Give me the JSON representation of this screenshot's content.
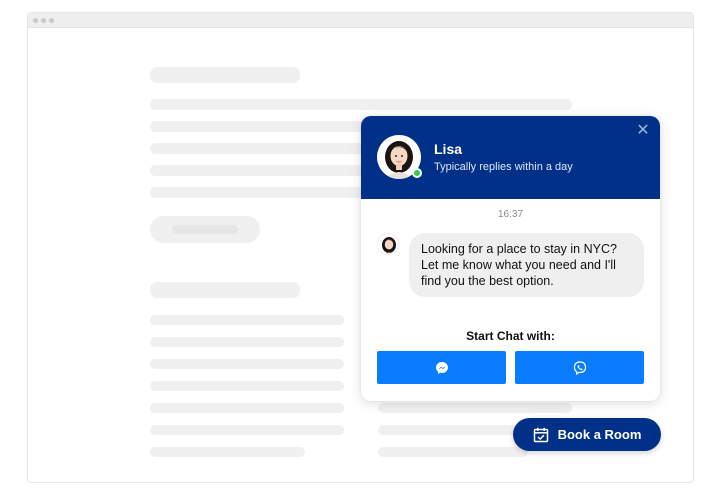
{
  "colors": {
    "header_bg": "#003087",
    "channel_button": "#0a7cff",
    "online": "#2ecc40",
    "bubble_bg": "#efefef"
  },
  "chat": {
    "agent_name": "Lisa",
    "agent_status": "Typically replies within a day",
    "close_icon": "close-icon",
    "timestamp": "16:37",
    "message": "Looking for a place to stay in NYC? Let me know what you need and I'll find you the best option.",
    "start_label": "Start Chat with:",
    "channels": [
      {
        "icon": "messenger-icon"
      },
      {
        "icon": "viber-icon"
      }
    ]
  },
  "book_button": {
    "label": "Book a Room",
    "icon": "calendar-check-icon"
  }
}
